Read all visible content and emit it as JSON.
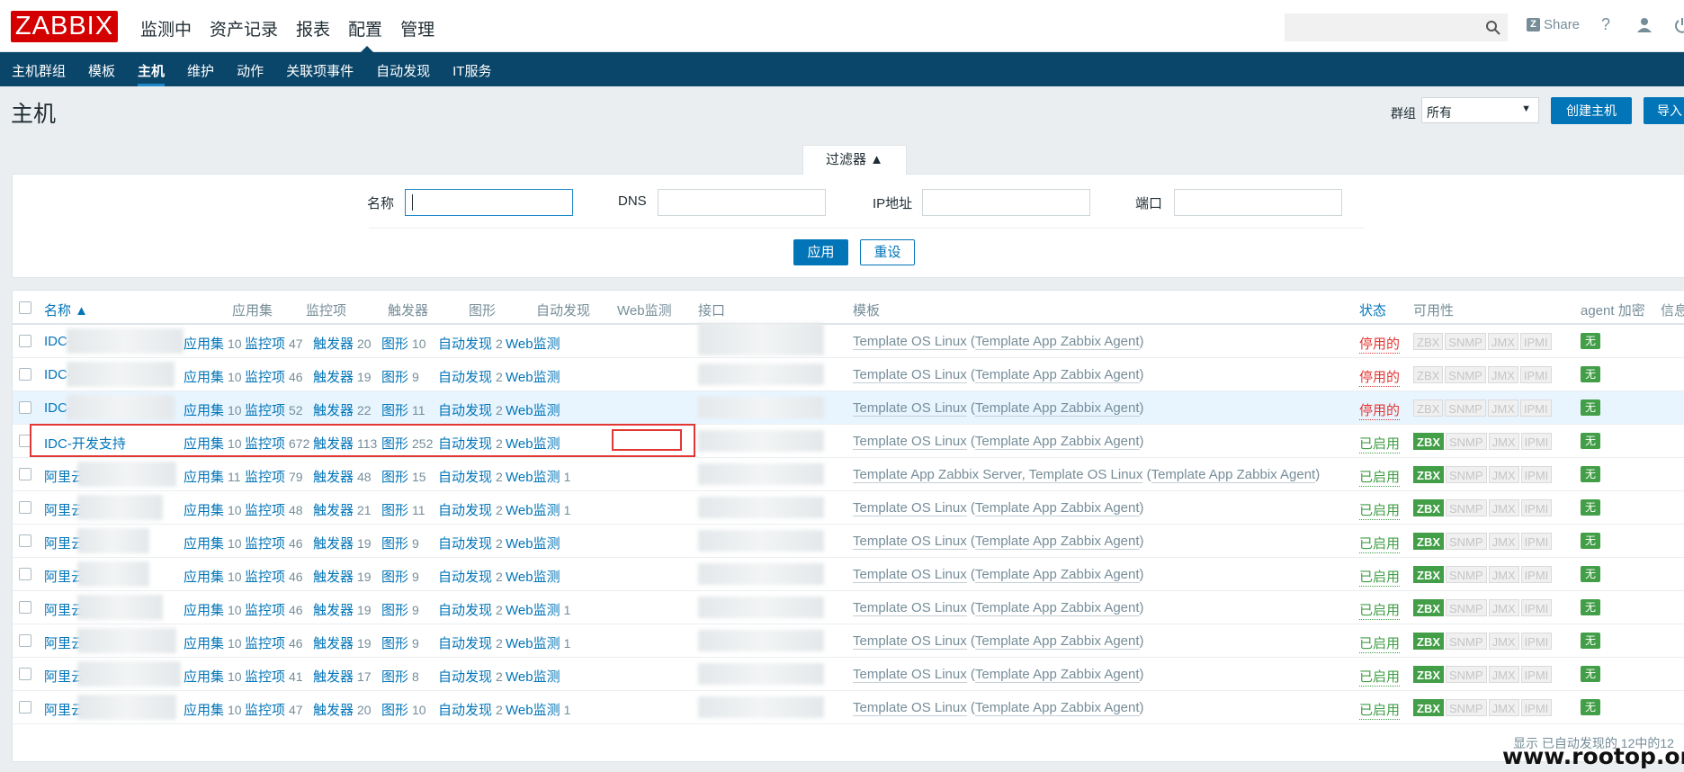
{
  "app": {
    "logo": "ZABBIX"
  },
  "top_menu": [
    "监测中",
    "资产记录",
    "报表",
    "配置",
    "管理"
  ],
  "top_menu_active": 3,
  "top_right": {
    "share": "Share",
    "share_icon": "Z",
    "help": "?"
  },
  "sub_menu": [
    "主机群组",
    "模板",
    "主机",
    "维护",
    "动作",
    "关联项事件",
    "自动发现",
    "IT服务"
  ],
  "sub_menu_active": 2,
  "page": {
    "title": "主机",
    "group_label": "群组",
    "group_value": "所有",
    "create_button": "创建主机",
    "import_button": "导入"
  },
  "filter": {
    "tab_label": "过滤器 ▲",
    "name_label": "名称",
    "dns_label": "DNS",
    "ip_label": "IP地址",
    "port_label": "端口",
    "apply": "应用",
    "reset": "重设"
  },
  "table": {
    "headers": {
      "name": "名称 ▲",
      "apps": "应用集",
      "items": "监控项",
      "triggers": "触发器",
      "graphs": "图形",
      "discovery": "自动发现",
      "web": "Web监测",
      "interface": "接口",
      "templates": "模板",
      "status": "状态",
      "availability": "可用性",
      "agent_enc": "agent 加密",
      "info": "信息"
    },
    "link_labels": {
      "apps": "应用集",
      "items": "监控项",
      "triggers": "触发器",
      "graphs": "图形",
      "discovery": "自动发现",
      "web": "Web监测"
    },
    "availability_labels": [
      "ZBX",
      "SNMP",
      "JMX",
      "IPMI"
    ],
    "rows": [
      {
        "name": "IDC-",
        "apps": "10",
        "items": "47",
        "triggers": "20",
        "graphs": "10",
        "discovery": "2",
        "web": "",
        "tpl_main": "Template OS Linux",
        "tpl_sub": "Template App Zabbix Agent",
        "status": "停用的",
        "enabled": false,
        "enc": "无"
      },
      {
        "name": "IDC-(",
        "apps": "10",
        "items": "46",
        "triggers": "19",
        "graphs": "9",
        "discovery": "2",
        "web": "",
        "tpl_main": "Template OS Linux",
        "tpl_sub": "Template App Zabbix Agent",
        "status": "停用的",
        "enabled": false,
        "enc": "无"
      },
      {
        "name": "IDC-(",
        "apps": "10",
        "items": "52",
        "triggers": "22",
        "graphs": "11",
        "discovery": "2",
        "web": "",
        "tpl_main": "Template OS Linux",
        "tpl_sub": "Template App Zabbix Agent",
        "status": "停用的",
        "enabled": false,
        "enc": "无"
      },
      {
        "name": "IDC-开发支持",
        "apps": "10",
        "items": "672",
        "triggers": "113",
        "graphs": "252",
        "discovery": "2",
        "web": "",
        "tpl_main": "Template OS Linux",
        "tpl_sub": "Template App Zabbix Agent",
        "status": "已启用",
        "enabled": true,
        "enc": "无"
      },
      {
        "name": "阿里云-",
        "apps": "11",
        "items": "79",
        "triggers": "48",
        "graphs": "15",
        "discovery": "2",
        "web": "1",
        "tpl_main": "Template App Zabbix Server, Template OS Linux",
        "tpl_sub": "Template App Zabbix Agent",
        "status": "已启用",
        "enabled": true,
        "enc": "无"
      },
      {
        "name": "阿里云-",
        "apps": "10",
        "items": "48",
        "triggers": "21",
        "graphs": "11",
        "discovery": "2",
        "web": "1",
        "tpl_main": "Template OS Linux",
        "tpl_sub": "Template App Zabbix Agent",
        "status": "已启用",
        "enabled": true,
        "enc": "无"
      },
      {
        "name": "阿里云-",
        "apps": "10",
        "items": "46",
        "triggers": "19",
        "graphs": "9",
        "discovery": "2",
        "web": "",
        "tpl_main": "Template OS Linux",
        "tpl_sub": "Template App Zabbix Agent",
        "status": "已启用",
        "enabled": true,
        "enc": "无"
      },
      {
        "name": "阿里云-",
        "apps": "10",
        "items": "46",
        "triggers": "19",
        "graphs": "9",
        "discovery": "2",
        "web": "",
        "tpl_main": "Template OS Linux",
        "tpl_sub": "Template App Zabbix Agent",
        "status": "已启用",
        "enabled": true,
        "enc": "无"
      },
      {
        "name": "阿里云-",
        "apps": "10",
        "items": "46",
        "triggers": "19",
        "graphs": "9",
        "discovery": "2",
        "web": "1",
        "tpl_main": "Template OS Linux",
        "tpl_sub": "Template App Zabbix Agent",
        "status": "已启用",
        "enabled": true,
        "enc": "无"
      },
      {
        "name": "阿里云-",
        "apps": "10",
        "items": "46",
        "triggers": "19",
        "graphs": "9",
        "discovery": "2",
        "web": "1",
        "tpl_main": "Template OS Linux",
        "tpl_sub": "Template App Zabbix Agent",
        "status": "已启用",
        "enabled": true,
        "enc": "无"
      },
      {
        "name": "阿里云-",
        "apps": "10",
        "items": "41",
        "triggers": "17",
        "graphs": "8",
        "discovery": "2",
        "web": "",
        "tpl_main": "Template OS Linux",
        "tpl_sub": "Template App Zabbix Agent",
        "status": "已启用",
        "enabled": true,
        "enc": "无"
      },
      {
        "name": "阿里云-",
        "apps": "10",
        "items": "47",
        "triggers": "20",
        "graphs": "10",
        "discovery": "2",
        "web": "1",
        "tpl_main": "Template OS Linux",
        "tpl_sub": "Template App Zabbix Agent",
        "status": "已启用",
        "enabled": true,
        "enc": "无"
      }
    ],
    "footer": "显示 已自动发现的 12中的12"
  },
  "watermark": "www.rootop.org",
  "colors": {
    "brand": "#d40000",
    "nav": "#0a466a",
    "link": "#0275b8",
    "enabled": "#429e47",
    "disabled": "#e33734"
  }
}
